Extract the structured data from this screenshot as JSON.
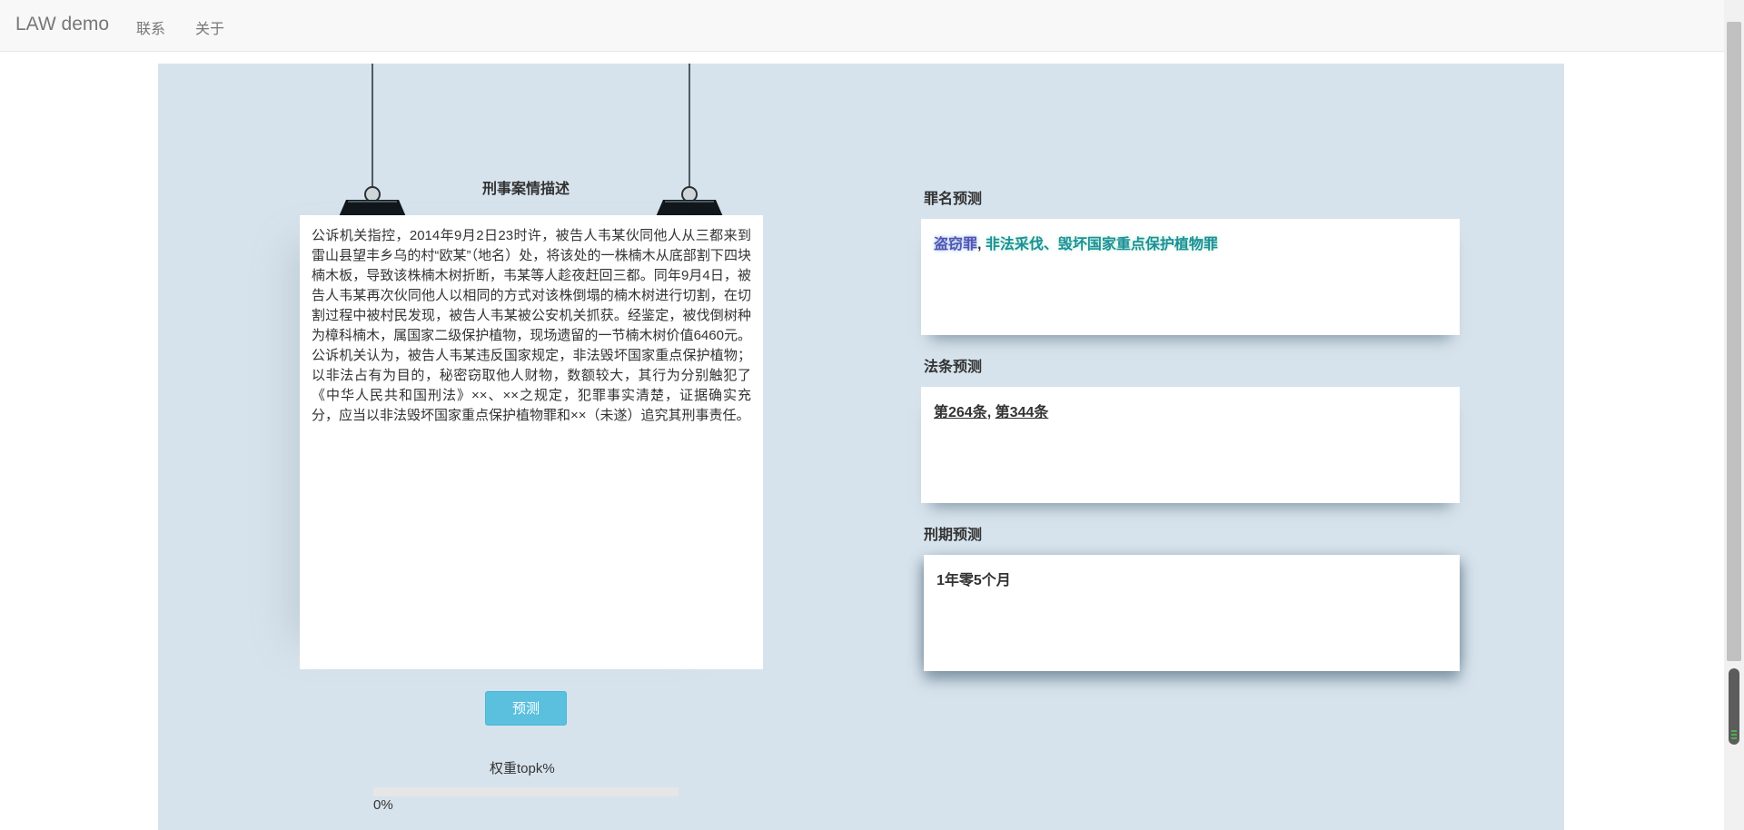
{
  "navbar": {
    "brand": "LAW demo",
    "links": [
      "联系",
      "关于"
    ]
  },
  "case_section": {
    "title": "刑事案情描述",
    "text": "公诉机关指控，2014年9月2日23时许，被告人韦某伙同他人从三都来到雷山县望丰乡乌的村“欧某”（地名）处，将该处的一株楠木从底部割下四块楠木板，导致该株楠木树折断，韦某等人趁夜赶回三都。同年9月4日，被告人韦某再次伙同他人以相同的方式对该株倒塌的楠木树进行切割，在切割过程中被村民发现，被告人韦某被公安机关抓获。经鉴定，被伐倒树种为樟科楠木，属国家二级保护植物，现场遗留的一节楠木树价值6460元。公诉机关认为，被告人韦某违反国家规定，非法毁坏国家重点保护植物；以非法占有为目的，秘密窃取他人财物，数额较大，其行为分别触犯了《中华人民共和国刑法》××、××之规定，犯罪事实清楚，证据确实充分，应当以非法毁坏国家重点保护植物罪和××（未遂）追究其刑事责任。"
  },
  "predict_button": "预测",
  "weight": {
    "label": "权重topk%",
    "value_text": "0%",
    "value": 0
  },
  "results": {
    "crime": {
      "title": "罪名预测",
      "item1": "盗窃罪",
      "sep": ", ",
      "item2": "非法采伐、毁坏国家重点保护植物罪"
    },
    "law": {
      "title": "法条预测",
      "item1": "第264条",
      "sep": ", ",
      "item2": "第344条"
    },
    "term": {
      "title": "刑期预测",
      "value": "1年零5个月"
    }
  },
  "colors": {
    "stage_bg": "#d7e3ec",
    "button": "#5bc0de",
    "navbar_bg": "#f8f8f8"
  }
}
